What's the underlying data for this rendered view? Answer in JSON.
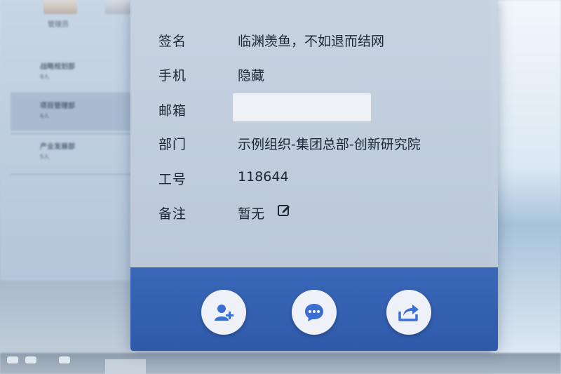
{
  "background": {
    "avatar_label": "管理员",
    "list_items": [
      {
        "title": "战略规划部",
        "subtitle": "9人"
      },
      {
        "title": "项目管理部",
        "subtitle": "6人"
      },
      {
        "title": "产业发展部",
        "subtitle": "5人"
      }
    ]
  },
  "profile": {
    "fields": [
      {
        "label": "签名",
        "value": "临渊羡鱼，不如退而结网"
      },
      {
        "label": "手机",
        "value": "隐藏"
      },
      {
        "label": "邮箱",
        "value": ""
      },
      {
        "label": "部门",
        "value": "示例组织-集团总部-创新研究院"
      },
      {
        "label": "工号",
        "value": "118644"
      },
      {
        "label": "备注",
        "value": "暂无"
      }
    ]
  },
  "actions": [
    {
      "icon": "add-friend-icon"
    },
    {
      "icon": "chat-bubble-icon"
    },
    {
      "icon": "share-icon"
    }
  ],
  "colors": {
    "action_bar": "#3a67b8",
    "action_icon": "#3b6fd4",
    "card_bg": "#c4cfdd"
  }
}
